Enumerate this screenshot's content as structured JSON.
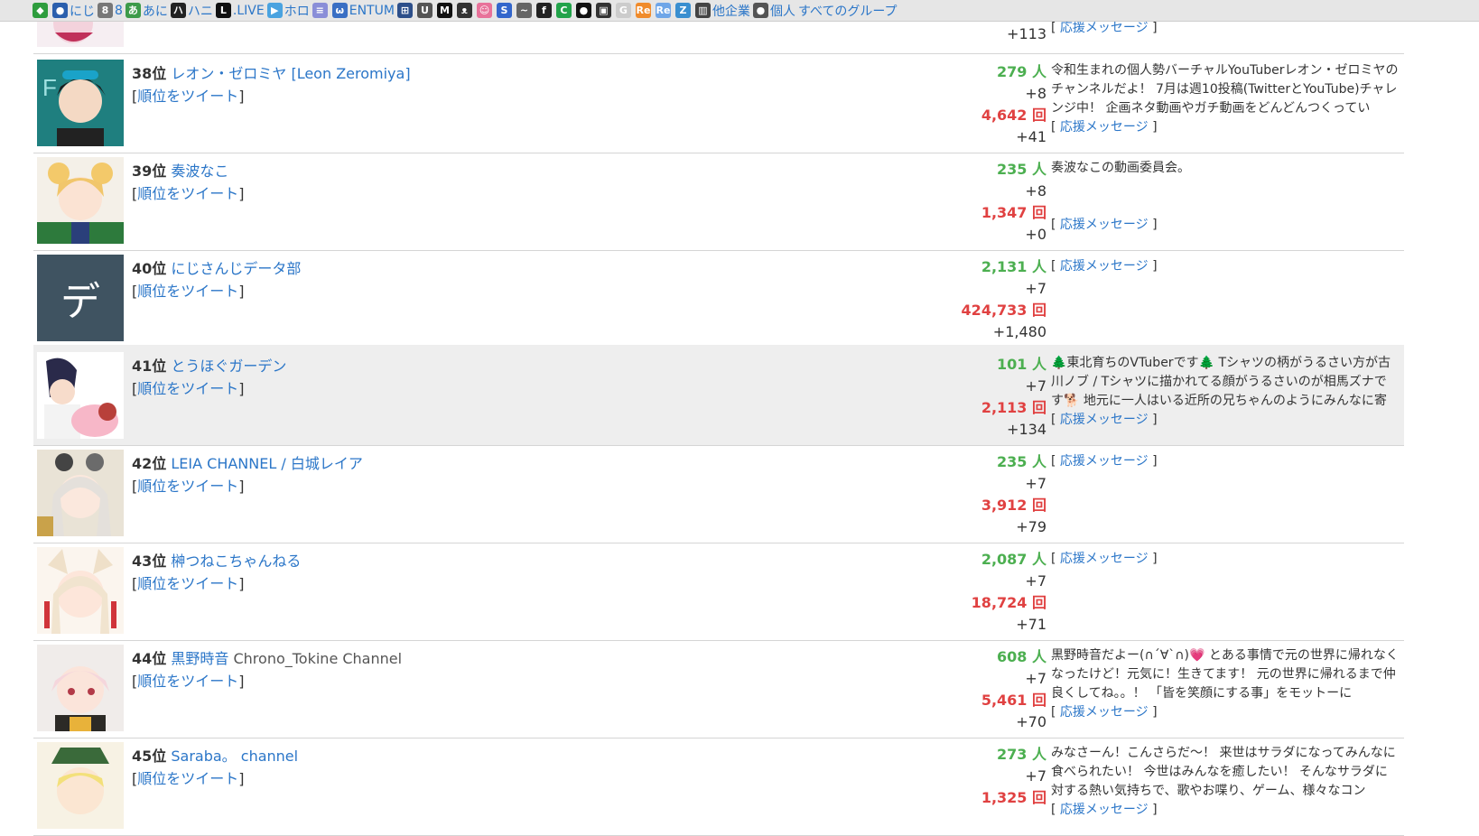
{
  "nav": [
    {
      "icon": "beginner-icon",
      "label": "",
      "color": "#2e9d3e"
    },
    {
      "icon": "globe-icon",
      "label": "にじ",
      "color": "#2b5fad"
    },
    {
      "icon": "eight-icon",
      "label": "8",
      "color": "#777777"
    },
    {
      "icon": "ani-icon",
      "label": "あに",
      "color": "#3d9b4a"
    },
    {
      "icon": "hani-icon",
      "label": "ハニ",
      "color": "#222222"
    },
    {
      "icon": "live-icon",
      "label": ".LIVE",
      "color": "#111111"
    },
    {
      "icon": "holo-icon",
      "label": "ホロ",
      "color": "#4aa3e0"
    },
    {
      "icon": "stripes-icon",
      "label": "",
      "color": "#8a8ed8"
    },
    {
      "icon": "entum-icon",
      "label": "ENTUM",
      "color": "#3a6fc4"
    },
    {
      "icon": "robot-icon",
      "label": "",
      "color": "#2d4f8a"
    },
    {
      "icon": "u-icon",
      "label": "",
      "color": "#555555"
    },
    {
      "icon": "m-icon",
      "label": "",
      "color": "#111111"
    },
    {
      "icon": "cat-icon",
      "label": "",
      "color": "#333333"
    },
    {
      "icon": "pink-face-icon",
      "label": "",
      "color": "#e8729a"
    },
    {
      "icon": "s-icon",
      "label": "",
      "color": "#3366cc"
    },
    {
      "icon": "feather-icon",
      "label": "",
      "color": "#666666"
    },
    {
      "icon": "fiefy-icon",
      "label": "",
      "color": "#222222"
    },
    {
      "icon": "green-c-icon",
      "label": "",
      "color": "#22a34a"
    },
    {
      "icon": "bomb-icon",
      "label": "",
      "color": "#111111"
    },
    {
      "icon": "ticket-icon",
      "label": "",
      "color": "#333333"
    },
    {
      "icon": "g-icon",
      "label": "",
      "color": "#cccccc"
    },
    {
      "icon": "re-icon",
      "label": "",
      "color": "#f08b2b"
    },
    {
      "icon": "re-blue-icon",
      "label": "",
      "color": "#6fa6e8"
    },
    {
      "icon": "z-icon",
      "label": "",
      "color": "#3a8fd0"
    },
    {
      "icon": "building-icon",
      "label": "他企業",
      "color": "#444444"
    },
    {
      "icon": "person-icon",
      "label": "個人",
      "color": "#555555"
    },
    {
      "icon": "",
      "label": "すべてのグループ",
      "color": ""
    }
  ],
  "top_partial": {
    "diff": "+113",
    "cheer": "応援メッセージ"
  },
  "rows": [
    {
      "rank": "38位",
      "name": "レオン・ゼロミヤ [Leon Zeromiya]",
      "suffix": "",
      "tweet": "順位をツイート",
      "subs": "279 人",
      "subs_diff": "+8",
      "views": "4,642 回",
      "views_diff": "+41",
      "desc": "令和生まれの個人勢バーチャルYouTuberレオン・ゼロミヤのチャンネルだよ！ 7月は週10投稿(TwitterとYouTube)チャレンジ中！ 企画ネタ動画やガチ動画をどんどんつくってい",
      "cheer": "応援メッセージ",
      "thumb": "leon",
      "highlight": false
    },
    {
      "rank": "39位",
      "name": "奏波なこ",
      "suffix": "",
      "tweet": "順位をツイート",
      "subs": "235 人",
      "subs_diff": "+8",
      "views": "1,347 回",
      "views_diff": "+0",
      "desc": "奏波なこの動画委員会。",
      "cheer": "応援メッセージ",
      "thumb": "nako",
      "highlight": false
    },
    {
      "rank": "40位",
      "name": "にじさんじデータ部",
      "suffix": "",
      "tweet": "順位をツイート",
      "subs": "2,131 人",
      "subs_diff": "+7",
      "views": "424,733 回",
      "views_diff": "+1,480",
      "desc": "",
      "cheer": "応援メッセージ",
      "thumb": "letter",
      "letter": "デ",
      "highlight": false
    },
    {
      "rank": "41位",
      "name": "とうほぐガーデン",
      "suffix": "",
      "tweet": "順位をツイート",
      "subs": "101 人",
      "subs_diff": "+7",
      "views": "2,113 回",
      "views_diff": "+134",
      "desc": "🌲東北育ちのVTuberです🌲 Tシャツの柄がうるさい方が古川ノブ / Tシャツに描かれてる顔がうるさいのが相馬ズナです🐕 地元に一人はいる近所の兄ちゃんのようにみんなに寄",
      "cheer": "応援メッセージ",
      "thumb": "touhogu",
      "highlight": true
    },
    {
      "rank": "42位",
      "name": "LEIA CHANNEL / 白城レイア",
      "suffix": "",
      "tweet": "順位をツイート",
      "subs": "235 人",
      "subs_diff": "+7",
      "views": "3,912 回",
      "views_diff": "+79",
      "desc": "",
      "cheer": "応援メッセージ",
      "thumb": "leia",
      "highlight": false
    },
    {
      "rank": "43位",
      "name": "榊つねこちゃんねる",
      "suffix": "",
      "tweet": "順位をツイート",
      "subs": "2,087 人",
      "subs_diff": "+7",
      "views": "18,724 回",
      "views_diff": "+71",
      "desc": "",
      "cheer": "応援メッセージ",
      "thumb": "tsuneko",
      "highlight": false
    },
    {
      "rank": "44位",
      "name": "黒野時音",
      "suffix": "Chrono_Tokine Channel",
      "tweet": "順位をツイート",
      "subs": "608 人",
      "subs_diff": "+7",
      "views": "5,461 回",
      "views_diff": "+70",
      "desc": "黒野時音だよー(∩´∀`∩)💗 とある事情で元の世界に帰れなくなったけど！元気に！生きてます！ 元の世界に帰れるまで仲良くしてね。。！ 「皆を笑顔にする事」をモットーに",
      "cheer": "応援メッセージ",
      "thumb": "tokine",
      "highlight": false
    },
    {
      "rank": "45位",
      "name": "Saraba。 channel",
      "suffix": "",
      "tweet": "順位をツイート",
      "subs": "273 人",
      "subs_diff": "+7",
      "views": "1,325 回",
      "views_diff": "",
      "desc": "みなさーん！こんさらだ～！ 来世はサラダになってみんなに食べられたい！ 今世はみんなを癒したい！ そんなサラダに対する熱い気持ちで、歌やお喋り、ゲーム、様々なコン",
      "cheer": "応援メッセージ",
      "thumb": "saraba",
      "highlight": false
    }
  ]
}
